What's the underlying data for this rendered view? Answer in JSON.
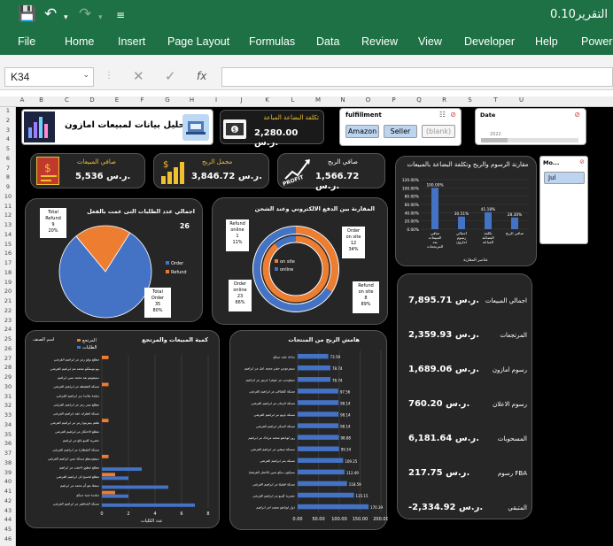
{
  "app": {
    "title": "التقرير0.10"
  },
  "ribbon": [
    "File",
    "Home",
    "Insert",
    "Page Layout",
    "Formulas",
    "Data",
    "Review",
    "View",
    "Developer",
    "Help",
    "Power"
  ],
  "formula_bar": {
    "name_box": "K34",
    "fx": "fx"
  },
  "columns": [
    "A",
    "B",
    "C",
    "D",
    "E",
    "F",
    "G",
    "H",
    "I",
    "J",
    "K",
    "L",
    "M",
    "N",
    "O",
    "P",
    "Q",
    "R",
    "S",
    "T",
    "U"
  ],
  "rows": [
    "1",
    "2",
    "3",
    "4",
    "5",
    "6",
    "7",
    "8",
    "9",
    "10",
    "11",
    "12",
    "13",
    "14",
    "15",
    "16",
    "17",
    "18",
    "19",
    "20",
    "21",
    "22",
    "23",
    "24",
    "25",
    "26",
    "27",
    "28",
    "29",
    "30",
    "31",
    "32",
    "33",
    "34",
    "35",
    "36",
    "37",
    "38",
    "39",
    "40",
    "41",
    "42",
    "43",
    "44",
    "45",
    "46"
  ],
  "dashboard": {
    "title": "تحليل بيانات لمبيعات امازون",
    "goods_cost": {
      "label": "تكلفة البضاعة المباعة",
      "value": "2,280.00 ر.س."
    },
    "net_sales": {
      "label": "صافي المبيعات",
      "value": "5,536 ر.س."
    },
    "gross_profit": {
      "label": "مجمل الربح",
      "value": "3,846.72 ر.س."
    },
    "net_profit": {
      "label": "صافي الربح",
      "value": "1,566.72 ر.س.",
      "icon_text": "PROFIT"
    },
    "fulfillment": {
      "title": "fulfillment",
      "options": [
        "Amazon",
        "Seller",
        "(blank)"
      ]
    },
    "date": {
      "title": "Date",
      "year": "2022"
    },
    "month": {
      "title": "Mo...",
      "option": "Jul"
    },
    "pie1": {
      "title": "اجمالي عدد الطلبات التى عمت بالفعل",
      "count": "26",
      "legend": [
        "Order",
        "Refund"
      ],
      "refund_label": [
        "Total",
        "Refund",
        "9",
        "20%"
      ],
      "order_label": [
        "Total",
        "Order",
        "35",
        "80%"
      ]
    },
    "donut": {
      "title": "المقارنة بين الدفع الالكتروني وعند الشحن",
      "legend": [
        "on site",
        "online"
      ],
      "labels": [
        [
          "Refund",
          "online",
          "1",
          "11%"
        ],
        [
          "Order",
          "on site",
          "12",
          "34%"
        ],
        [
          "Order",
          "online",
          "23",
          "66%"
        ],
        [
          "Refund",
          "on site",
          "8",
          "89%"
        ]
      ]
    },
    "cost_chart": {
      "title": "مقارنة الرسوم والربح وتكلفة البضاعة بالمبيعات",
      "axis_title": "عناصر المقارنة",
      "yticks": [
        "120.00%",
        "100.00%",
        "80.00%",
        "60.00%",
        "40.00%",
        "20.00%",
        "0.00%"
      ],
      "categories": [
        "صافي المبيعات بعد المرتجعات",
        "اجمالي رسوم امازون",
        "تكلفة البضاعة المباعة",
        "صافي الربح"
      ],
      "values": [
        100,
        30.51,
        41.18,
        28.3
      ],
      "labels": [
        "100.00%",
        "30.51%",
        "41.18%",
        "28.30%"
      ]
    },
    "summary": [
      {
        "label": "اجمالي المبيعات",
        "value": "7,895.71 ر.س."
      },
      {
        "label": "المرتجعات",
        "value": "2,359.93 ر.س."
      },
      {
        "label": "رسوم امازون",
        "value": "1,689.06 ر.س."
      },
      {
        "label": "رسوم الاعلان",
        "value": "760.20 ر.س."
      },
      {
        "label": "المسحوبات",
        "value": "6,181.64 ر.س."
      },
      {
        "label": "رسوم FBA",
        "value": "217.75 ر.س."
      },
      {
        "label": "المتبقي",
        "value": "-2,334.92 ر.س."
      }
    ],
    "qty_chart": {
      "title": "كمية المبيعات والمرتجع",
      "axis_label": "اسم الصنف",
      "xlabel": "عدد الكليات",
      "legend": [
        "المرتجع",
        "الطلبات"
      ],
      "xticks": [
        "0",
        "2",
        "4",
        "6",
        "8"
      ],
      "items": [
        "مطلع بولو رمز مر ابراهيم القرشي",
        "بيو توسلكو محمد مم ابراهيم القرشي",
        "ستيفومو بفد محمد مس ابراهيم",
        "مسكة القشطة مر ابراهيم القرشي",
        "سلحة ملاسا سر ابراهيم القرشي",
        "مطلع بمبر رمز مر ابراهيم القرشي",
        "مسكة فطران عقد ابراهيم القرشي",
        "طقم بيفرموا رمز مر ابراهيم القرشي",
        "مطلع الاحتكار مر ابراهيم القرشي",
        "حضرية كلنيو بالغ مر ابراهيم",
        "مسكة الشطارة مر ابراهيم القرشي",
        "سيقوسطو مسكة مس ابراهيم القرشي",
        "مطلع تنطوو لاحقت مر ابراهيم",
        "مطلع لخسح ابل ابراهيم القرشي",
        "ستفلا بغو أم محمد مر ابراهيم",
        "سلسة منيه سيكو",
        "مسكة الخناطير مر ابراهيم القرشي"
      ],
      "orders": [
        0,
        0,
        0,
        0,
        0,
        0,
        0,
        0,
        0,
        0,
        0,
        0,
        3,
        2,
        5,
        2,
        7
      ],
      "returns": [
        0.5,
        0,
        0,
        0.5,
        0,
        0,
        0,
        0.5,
        0,
        0,
        0,
        0.5,
        0,
        1,
        0,
        1,
        0
      ]
    },
    "margin_chart": {
      "title": "هامش الربح من المنتجات",
      "xticks": [
        "0.00",
        "50.00",
        "100.00",
        "150.00",
        "200.00"
      ],
      "items": [
        "ساعة ملبه سيكو",
        "سيفرموس حقير محمد امل مر ابراهيم",
        "سيقوسي مر جوهرا عربور مر ابراهيم",
        "مسكة كلشاقي مر ابراهيم القرشي",
        "مسكة الزمان مر ابراهيم القرشي",
        "مسكة باونو مر ابراهيم القرشي",
        "مسكة السكر ابراهيم القرشي",
        "روز لوبانقو محمد مرادك مر ابراهيم",
        "سسكة تبيشن مر ابراهيم القرشي",
        "مسكة بمر ابراهيم القرشي",
        "سنبكون سكو مس (الانجار القرشة)",
        "مسكة قشيلا مر ابراهيم القرشي",
        "حضرية كلبيو مر ابراهيم القرشي",
        "ذول لوبانقو محمد امر ابراهيم"
      ],
      "values": [
        73.59,
        78.74,
        78.74,
        97.56,
        98.14,
        98.14,
        98.14,
        98.88,
        99.34,
        109.25,
        112.49,
        118.59,
        135.15,
        170.39
      ],
      "labels": [
        "73.59",
        "78.74",
        "78.74",
        "97.56",
        "98.14",
        "98.14",
        "98.14",
        "98.88",
        "99.34",
        "109.25",
        "112.49",
        "118.59",
        "135.15",
        "170.39"
      ]
    }
  },
  "colors": {
    "excel_green": "#1e7145",
    "accent_blue": "#4472c4",
    "accent_orange": "#ed7d31",
    "gold": "#f0c030"
  }
}
